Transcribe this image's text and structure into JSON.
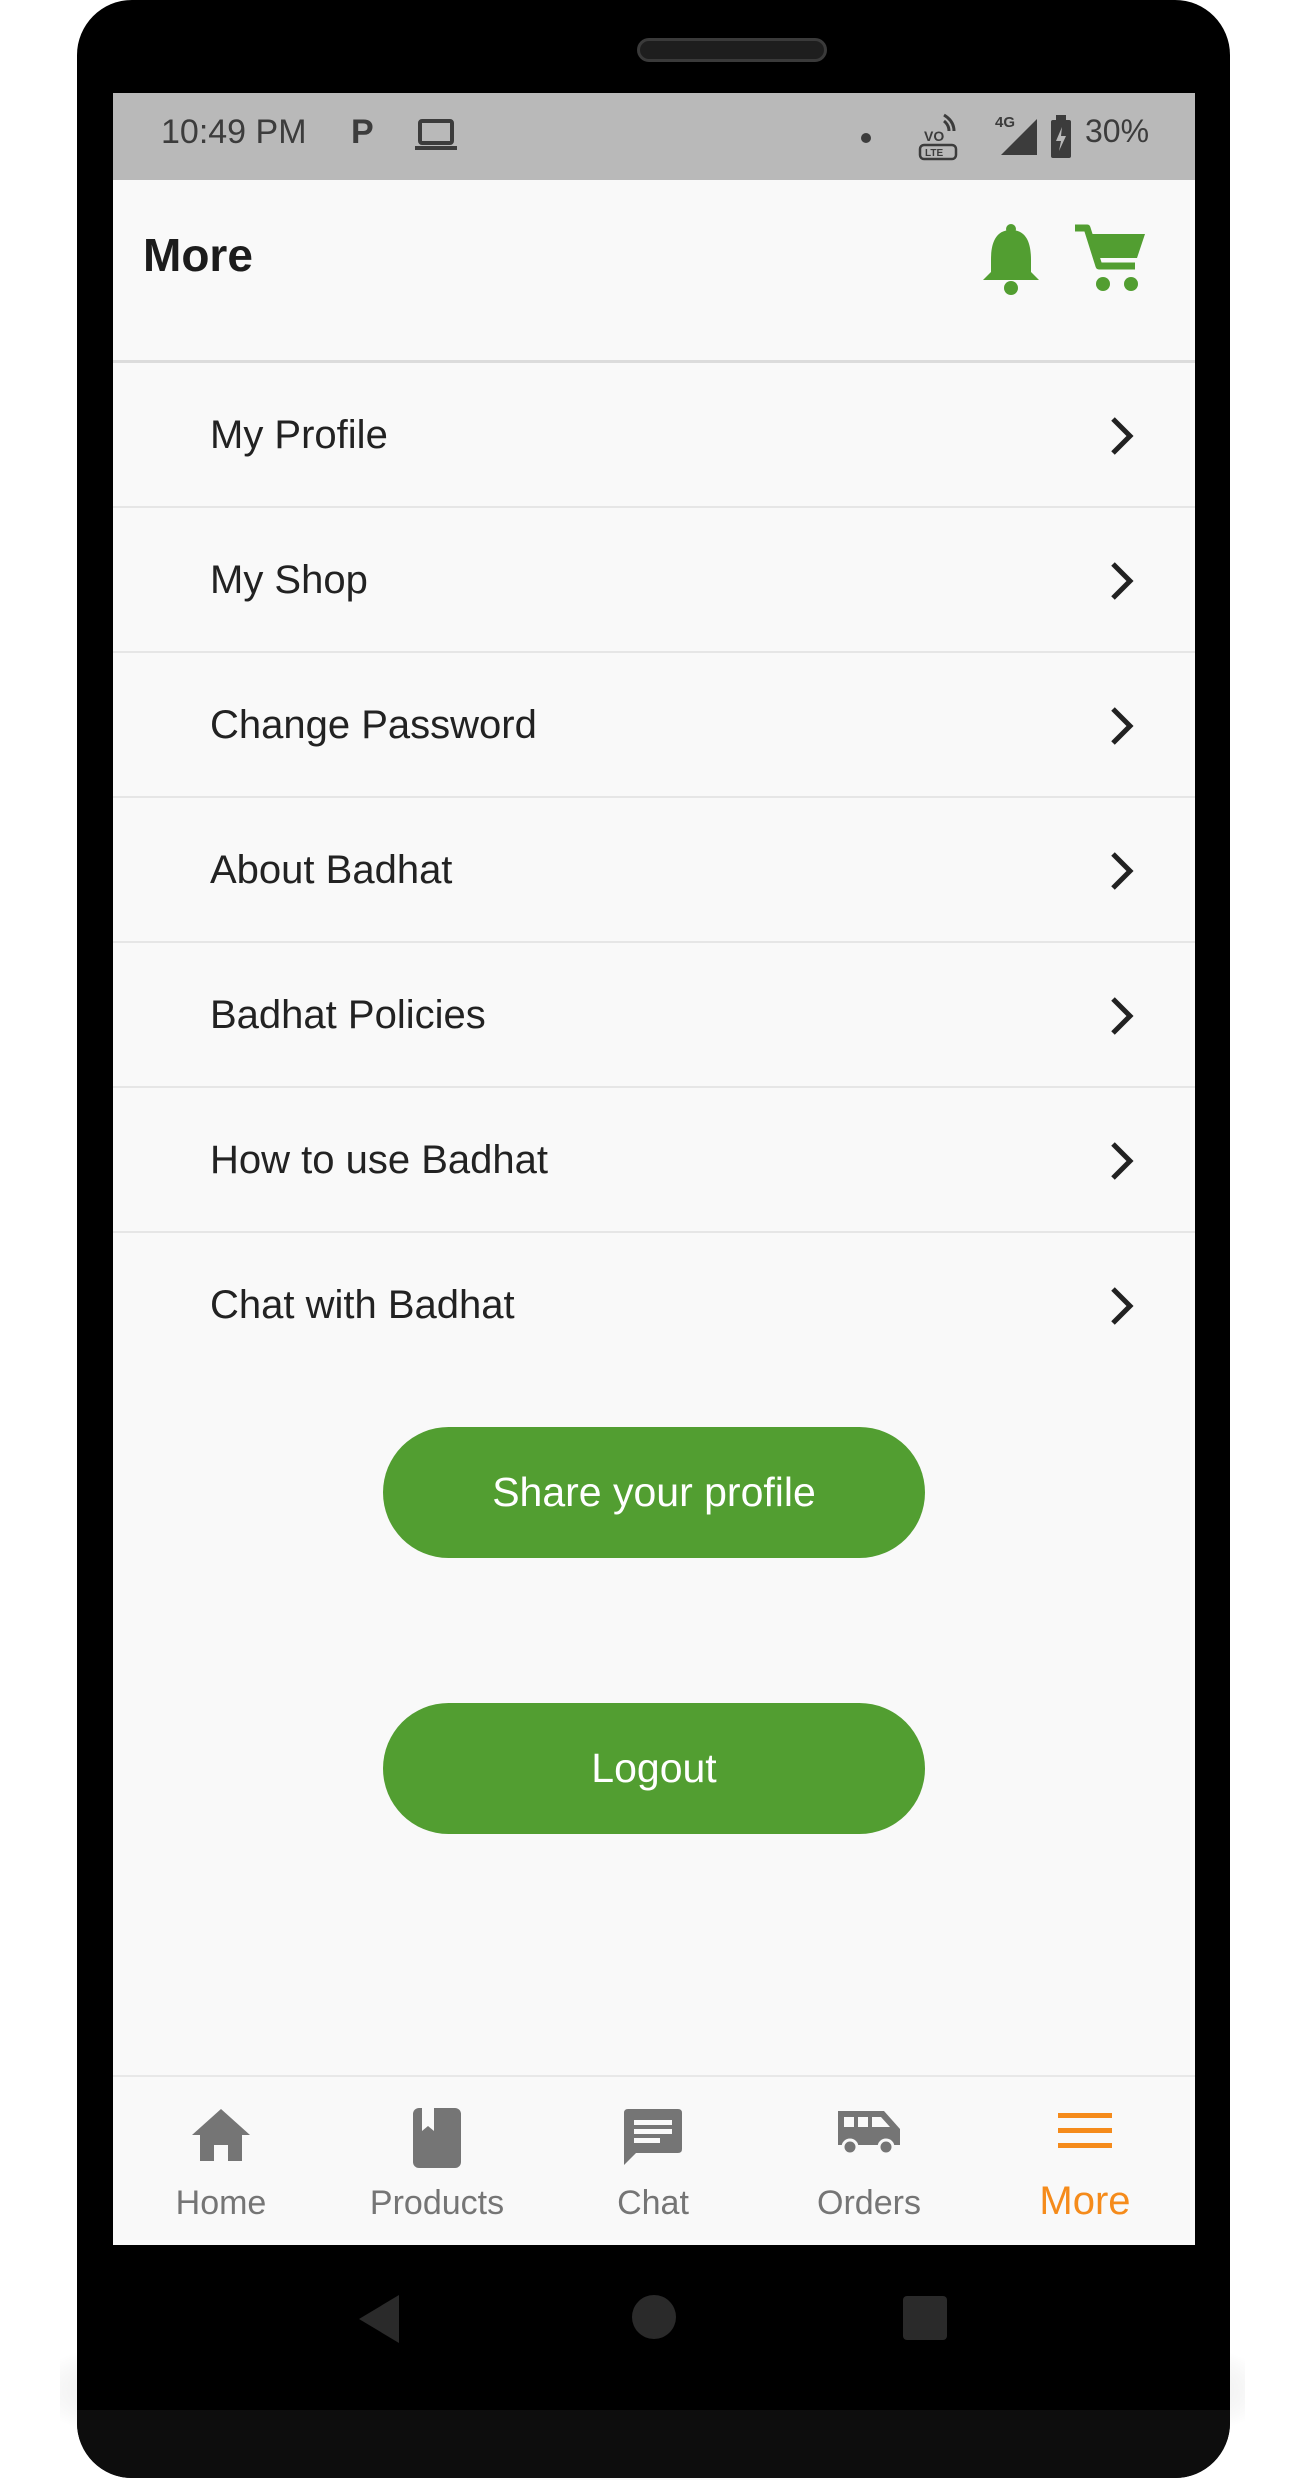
{
  "colors": {
    "brand_green": "#529e31",
    "active_orange": "#f58b1b",
    "inactive_gray": "#757575",
    "status_bar": "#b9b9b9"
  },
  "status_bar": {
    "time": "10:49 PM",
    "app_badge": "P",
    "battery_percent": "30%",
    "network": "4G",
    "icons": [
      "p-app-icon",
      "laptop-icon",
      "dot-icon",
      "volte-icon",
      "signal-4g-icon",
      "battery-icon"
    ]
  },
  "header": {
    "title": "More",
    "actions": [
      "bell-icon",
      "cart-icon"
    ]
  },
  "menu": {
    "items": [
      {
        "label": "My Profile"
      },
      {
        "label": "My Shop"
      },
      {
        "label": "Change Password"
      },
      {
        "label": "About Badhat"
      },
      {
        "label": "Badhat Policies"
      },
      {
        "label": "How to use Badhat"
      },
      {
        "label": "Chat with Badhat"
      }
    ]
  },
  "buttons": {
    "share": "Share your profile",
    "logout": "Logout"
  },
  "bottom_nav": {
    "items": [
      {
        "label": "Home",
        "icon": "home-icon"
      },
      {
        "label": "Products",
        "icon": "book-icon"
      },
      {
        "label": "Chat",
        "icon": "chat-icon"
      },
      {
        "label": "Orders",
        "icon": "van-icon"
      },
      {
        "label": "More",
        "icon": "menu-icon"
      }
    ],
    "active": "More"
  }
}
